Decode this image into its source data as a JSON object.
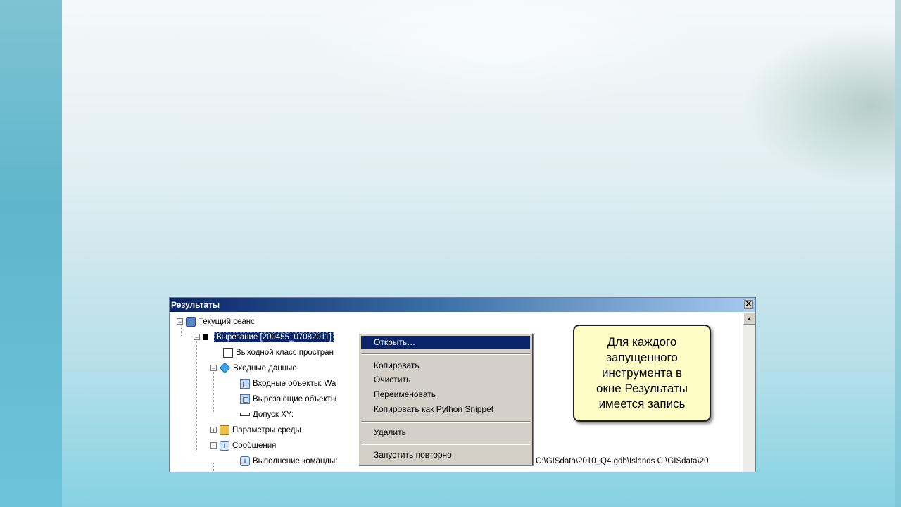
{
  "window": {
    "title": "Результаты",
    "close_glyph": "✕"
  },
  "tree": {
    "session": "Текущий сеанс",
    "tool_item": "Вырезание [200455_07082011]",
    "output_class": "Выходной класс простран",
    "input_data": "Входные данные",
    "input_objects": "Входные объекты: Wa",
    "clip_objects": "Вырезающие объекты",
    "xy_tolerance": "Допуск XY:",
    "env_params": "Параметры среды",
    "messages": "Сообщения",
    "command_exec": "Выполнение команды:",
    "command_tail": "C:\\GISdata\\2010_Q4.gdb\\Islands C:\\GISdata\\20"
  },
  "context_menu": {
    "items": [
      {
        "label": "Открыть…",
        "active": true
      },
      {
        "label": "Копировать"
      },
      {
        "label": "Очистить"
      },
      {
        "label": "Переименовать"
      },
      {
        "label": "Копировать как Python Snippet"
      },
      {
        "label": "Удалить"
      },
      {
        "label": "Запустить повторно"
      }
    ]
  },
  "callout": {
    "lines": [
      "Для каждого",
      "запущенного",
      "инструмента в",
      "окне Результаты",
      "имеется запись"
    ]
  },
  "icons": {
    "session": "results-session-icon",
    "messages": "info-icon",
    "env": "environment-icon"
  },
  "colors": {
    "selection": "#0a246a",
    "callout_bg": "#fffdc6",
    "menu_bg": "#d4d0c8"
  }
}
